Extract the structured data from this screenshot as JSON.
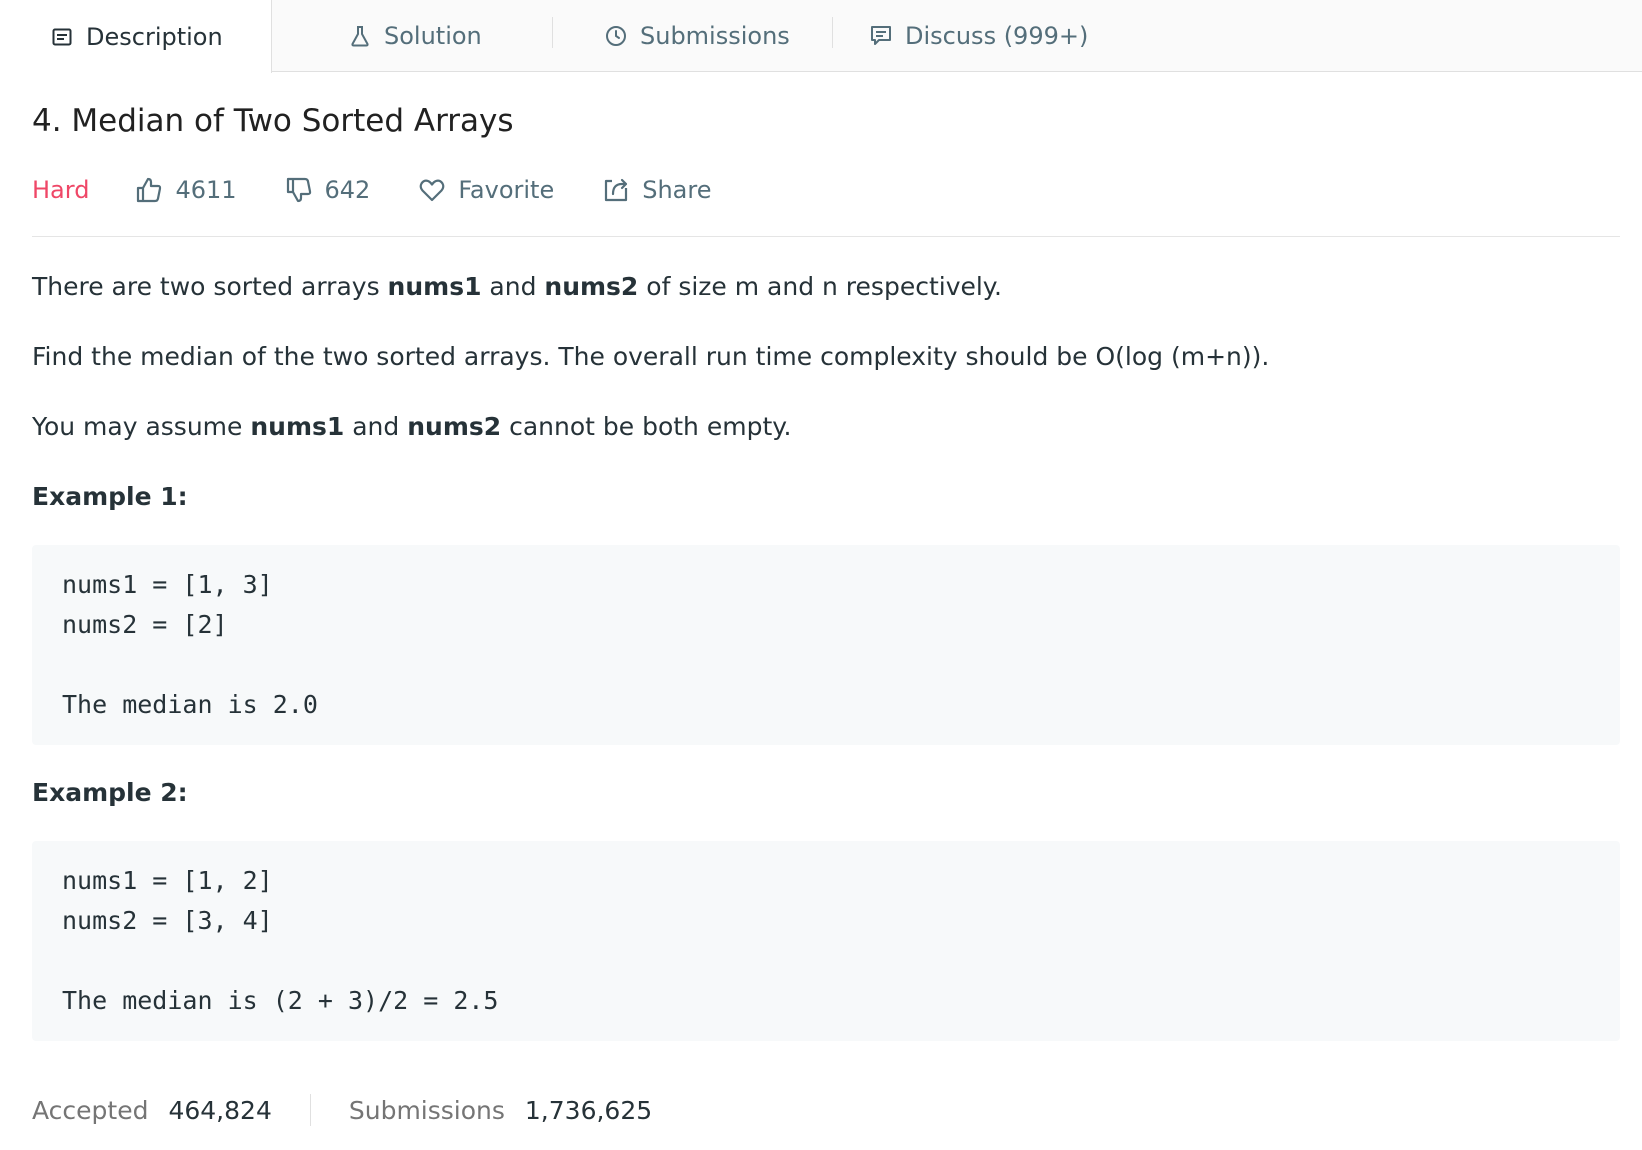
{
  "tabs": {
    "description": "Description",
    "solution": "Solution",
    "submissions": "Submissions",
    "discuss": "Discuss (999+)"
  },
  "problem": {
    "title": "4. Median of Two Sorted Arrays",
    "difficulty": "Hard",
    "likes": "4611",
    "dislikes": "642",
    "favorite_label": "Favorite",
    "share_label": "Share",
    "difficulty_color": "#ef4767"
  },
  "description": {
    "p1": {
      "t1": "There are two sorted arrays ",
      "b1": "nums1",
      "t2": " and ",
      "b2": "nums2",
      "t3": " of size m and n respectively."
    },
    "p2": "Find the median of the two sorted arrays. The overall run time complexity should be O(log (m+n)).",
    "p3": {
      "t1": "You may assume ",
      "b1": "nums1",
      "t2": " and ",
      "b2": "nums2",
      "t3": " cannot be both empty."
    }
  },
  "examples": [
    {
      "heading": "Example 1:",
      "lines": [
        "nums1 = [1, 3]",
        "nums2 = [2]",
        "",
        "The median is 2.0"
      ]
    },
    {
      "heading": "Example 2:",
      "lines": [
        "nums1 = [1, 2]",
        "nums2 = [3, 4]",
        "",
        "The median is (2 + 3)/2 = 2.5"
      ]
    }
  ],
  "stats": {
    "accepted_label": "Accepted",
    "accepted_value": "464,824",
    "submissions_label": "Submissions",
    "submissions_value": "1,736,625"
  }
}
